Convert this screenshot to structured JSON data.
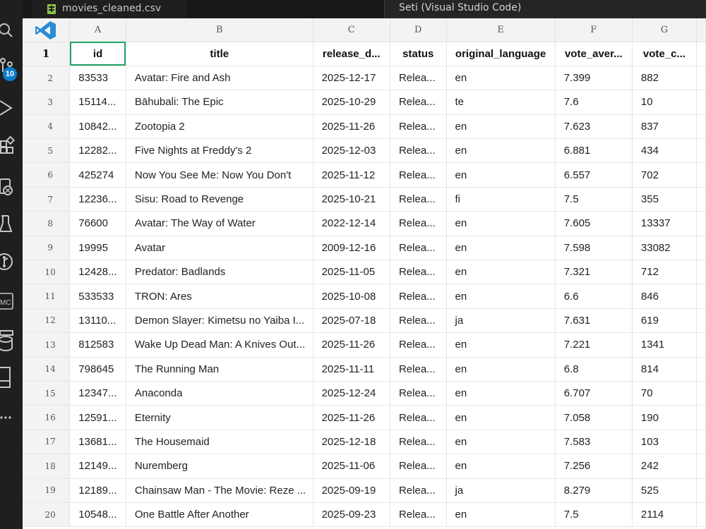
{
  "editor": {
    "tab": {
      "file_name": "movies_cleaned.csv"
    },
    "tooltip": "Seti (Visual Studio Code)"
  },
  "activity_bar": {
    "icons": [
      "search-icon",
      "source-control-icon",
      "run-debug-icon",
      "extensions-icon",
      "remote-explorer-icon",
      "testing-icon",
      "git-graph-icon",
      "mc-icon",
      "database-icon",
      "panel-icon",
      "more-icon"
    ],
    "source_control_badge": "10"
  },
  "sheet": {
    "columns": [
      "A",
      "B",
      "C",
      "D",
      "E",
      "F",
      "G"
    ],
    "header": [
      "id",
      "title",
      "release_d...",
      "status",
      "original_language",
      "vote_aver...",
      "vote_c..."
    ],
    "rows": [
      {
        "n": "1"
      },
      {
        "n": "2",
        "cells": [
          "83533",
          "Avatar: Fire and Ash",
          "2025-12-17",
          "Relea...",
          "en",
          "7.399",
          "882"
        ]
      },
      {
        "n": "3",
        "cells": [
          "15114...",
          "Bāhubali: The Epic",
          "2025-10-29",
          "Relea...",
          "te",
          "7.6",
          "10"
        ]
      },
      {
        "n": "4",
        "cells": [
          "10842...",
          "Zootopia 2",
          "2025-11-26",
          "Relea...",
          "en",
          "7.623",
          "837"
        ]
      },
      {
        "n": "5",
        "cells": [
          "12282...",
          "Five Nights at Freddy's 2",
          "2025-12-03",
          "Relea...",
          "en",
          "6.881",
          "434"
        ]
      },
      {
        "n": "6",
        "cells": [
          "425274",
          "Now You See Me: Now You Don't",
          "2025-11-12",
          "Relea...",
          "en",
          "6.557",
          "702"
        ]
      },
      {
        "n": "7",
        "cells": [
          "12236...",
          "Sisu: Road to Revenge",
          "2025-10-21",
          "Relea...",
          "fi",
          "7.5",
          "355"
        ]
      },
      {
        "n": "8",
        "cells": [
          "76600",
          "Avatar: The Way of Water",
          "2022-12-14",
          "Relea...",
          "en",
          "7.605",
          "13337"
        ]
      },
      {
        "n": "9",
        "cells": [
          "19995",
          "Avatar",
          "2009-12-16",
          "Relea...",
          "en",
          "7.598",
          "33082"
        ]
      },
      {
        "n": "10",
        "cells": [
          "12428...",
          "Predator: Badlands",
          "2025-11-05",
          "Relea...",
          "en",
          "7.321",
          "712"
        ]
      },
      {
        "n": "11",
        "cells": [
          "533533",
          "TRON: Ares",
          "2025-10-08",
          "Relea...",
          "en",
          "6.6",
          "846"
        ]
      },
      {
        "n": "12",
        "cells": [
          "13110...",
          "Demon Slayer: Kimetsu no Yaiba I...",
          "2025-07-18",
          "Relea...",
          "ja",
          "7.631",
          "619"
        ]
      },
      {
        "n": "13",
        "cells": [
          "812583",
          "Wake Up Dead Man: A Knives Out...",
          "2025-11-26",
          "Relea...",
          "en",
          "7.221",
          "1341"
        ]
      },
      {
        "n": "14",
        "cells": [
          "798645",
          "The Running Man",
          "2025-11-11",
          "Relea...",
          "en",
          "6.8",
          "814"
        ]
      },
      {
        "n": "15",
        "cells": [
          "12347...",
          "Anaconda",
          "2025-12-24",
          "Relea...",
          "en",
          "6.707",
          "70"
        ]
      },
      {
        "n": "16",
        "cells": [
          "12591...",
          "Eternity",
          "2025-11-26",
          "Relea...",
          "en",
          "7.058",
          "190"
        ]
      },
      {
        "n": "17",
        "cells": [
          "13681...",
          "The Housemaid",
          "2025-12-18",
          "Relea...",
          "en",
          "7.583",
          "103"
        ]
      },
      {
        "n": "18",
        "cells": [
          "12149...",
          "Nuremberg",
          "2025-11-06",
          "Relea...",
          "en",
          "7.256",
          "242"
        ]
      },
      {
        "n": "19",
        "cells": [
          "12189...",
          "Chainsaw Man - The Movie: Reze ...",
          "2025-09-19",
          "Relea...",
          "ja",
          "8.279",
          "525"
        ]
      },
      {
        "n": "20",
        "cells": [
          "10548...",
          "One Battle After Another",
          "2025-09-23",
          "Relea...",
          "en",
          "7.5",
          "2114"
        ]
      }
    ]
  },
  "colors": {
    "selection": "#21a366",
    "vscode_blue": "#2a8bd6",
    "badge": "#0a7ccc",
    "csv_icon": "#8bc34a"
  }
}
